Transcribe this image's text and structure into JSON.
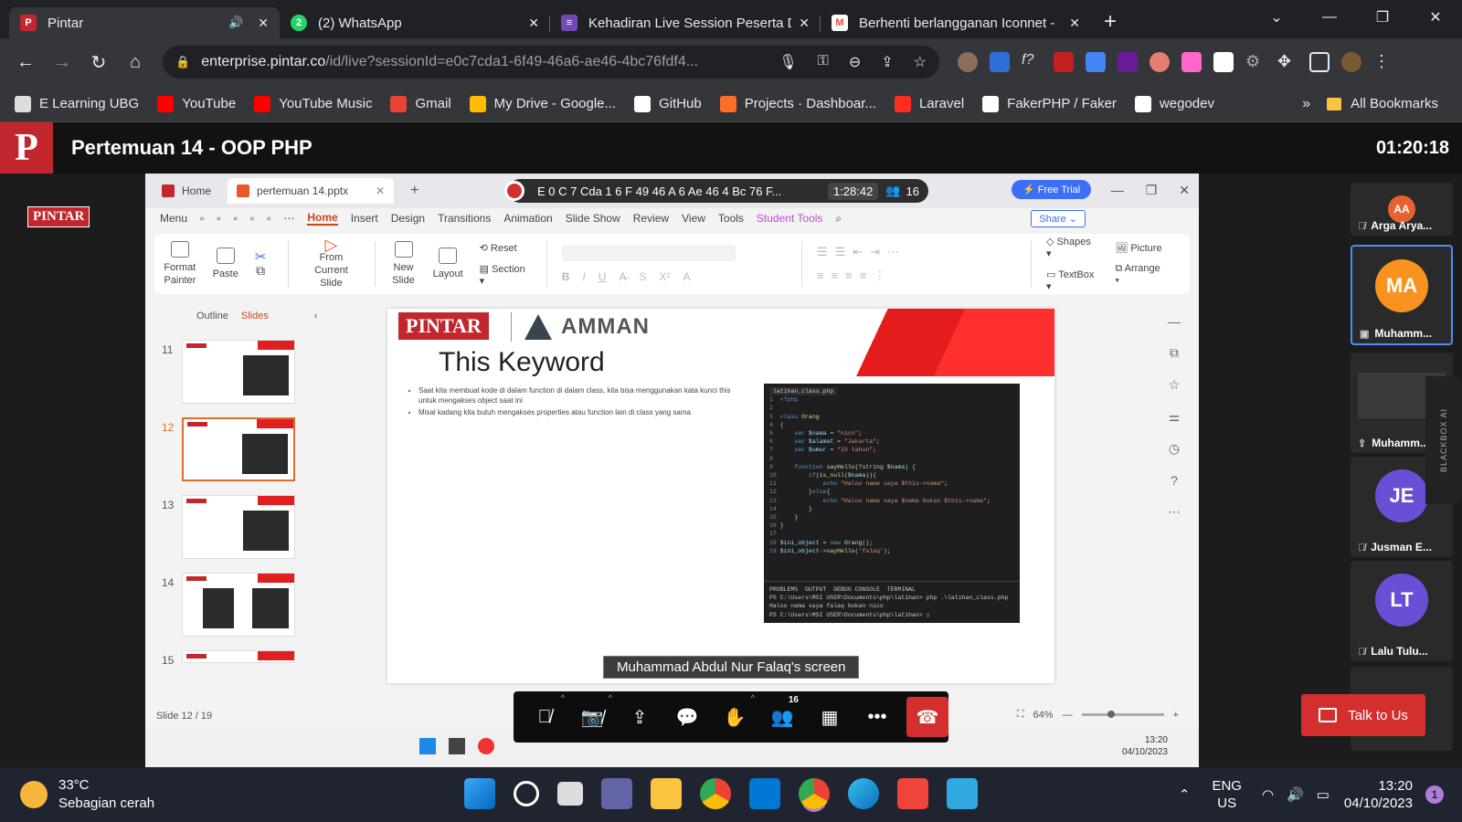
{
  "browser": {
    "tabs": [
      {
        "title": "Pintar",
        "icon": "pintar-icon",
        "color": "#c2272d",
        "letter": "P"
      },
      {
        "title": "(2) WhatsApp",
        "icon": "whatsapp-icon",
        "color": "#25d366",
        "letter": "2"
      },
      {
        "title": "Kehadiran Live Session Peserta D",
        "icon": "forms-icon",
        "color": "#7248b9",
        "letter": "≡"
      },
      {
        "title": "Berhenti berlangganan Iconnet -",
        "icon": "gmail-icon",
        "color": "#ea4335",
        "letter": "M"
      }
    ],
    "url_host": "enterprise.pintar.co",
    "url_path": "/id/live?sessionId=e0c7cda1-6f49-46a6-ae46-4bc76fdf4...",
    "bookmarks": [
      {
        "label": "E Learning UBG",
        "color": "#ddd"
      },
      {
        "label": "YouTube",
        "color": "#ff0000"
      },
      {
        "label": "YouTube Music",
        "color": "#ff0000"
      },
      {
        "label": "Gmail",
        "color": "#ea4335"
      },
      {
        "label": "My Drive - Google...",
        "color": "#fbbc04"
      },
      {
        "label": "GitHub",
        "color": "#ffffff"
      },
      {
        "label": "Projects · Dashboar...",
        "color": "#fc6d26"
      },
      {
        "label": "Laravel",
        "color": "#ff2d20"
      },
      {
        "label": "FakerPHP / Faker",
        "color": "#ffffff"
      },
      {
        "label": "wegodev",
        "color": "#ffffff"
      }
    ],
    "bookmarks_more": "»",
    "all_bookmarks": "All Bookmarks"
  },
  "meeting": {
    "title": "Pertemuan 14 - OOP PHP",
    "timer": "01:20:18",
    "logo_letter": "P",
    "side_badge": "PINTAR",
    "screen_label": "Muhammad Abdul Nur Falaq's screen",
    "participants_badge": "16",
    "talk_label": "Talk to Us",
    "blackbox": "BLACKBOX AI"
  },
  "wps": {
    "tab_home": "Home",
    "tab_file": "pertemuan 14.pptx",
    "rec_session": "E 0 C 7 Cda 1 6 F 49 46 A 6 Ae 46 4 Bc 76 F...",
    "rec_time": "1:28:42",
    "rec_count": "16",
    "free_trial": "Free Trial",
    "menu": [
      "Menu",
      "Home",
      "Insert",
      "Design",
      "Transitions",
      "Animation",
      "Slide Show",
      "Review",
      "View",
      "Tools",
      "Student Tools"
    ],
    "share": "Share",
    "ribbon": {
      "format_painter": "Format Painter",
      "paste": "Paste",
      "from_current": "From Current Slide",
      "new_slide": "New Slide",
      "layout": "Layout",
      "reset": "Reset",
      "section": "Section",
      "shapes": "Shapes",
      "picture": "Picture",
      "textbox": "TextBox",
      "arrange": "Arrange"
    },
    "pane_outline": "Outline",
    "pane_slides": "Slides",
    "thumb_numbers": [
      "11",
      "12",
      "13",
      "14",
      "15"
    ],
    "status": "Slide 12 / 19",
    "zoom": "64%",
    "inner_time": "13:20",
    "inner_date": "04/10/2023"
  },
  "slide": {
    "brand": "PINTAR",
    "partner": "AMMAN",
    "title": "This Keyword",
    "bullets": [
      "Saat kita membuat kode di dalam function di dalam class, kita bisa menggunakan kata kunci this untuk mengakses object saat ini",
      "Misal kadang kita butuh mengakses properties atau function lain di class yang sama"
    ],
    "code_tab": "latihan_class.php"
  },
  "participants": [
    {
      "initials": "AA",
      "name": "Arga Arya...",
      "color": "#e8622f"
    },
    {
      "initials": "MA",
      "name": "Muhamm...",
      "color": "#f7931e"
    },
    {
      "initials": "",
      "name": "Muhamm...",
      "color": "#2a2a2a"
    },
    {
      "initials": "JE",
      "name": "Jusman E...",
      "color": "#6a4fd6"
    },
    {
      "initials": "LT",
      "name": "Lalu Tulu...",
      "color": "#6a4fd6"
    }
  ],
  "taskbar": {
    "temp": "33°C",
    "weather": "Sebagian cerah",
    "lang1": "ENG",
    "lang2": "US",
    "time": "13:20",
    "date": "04/10/2023",
    "notifications": "1"
  }
}
